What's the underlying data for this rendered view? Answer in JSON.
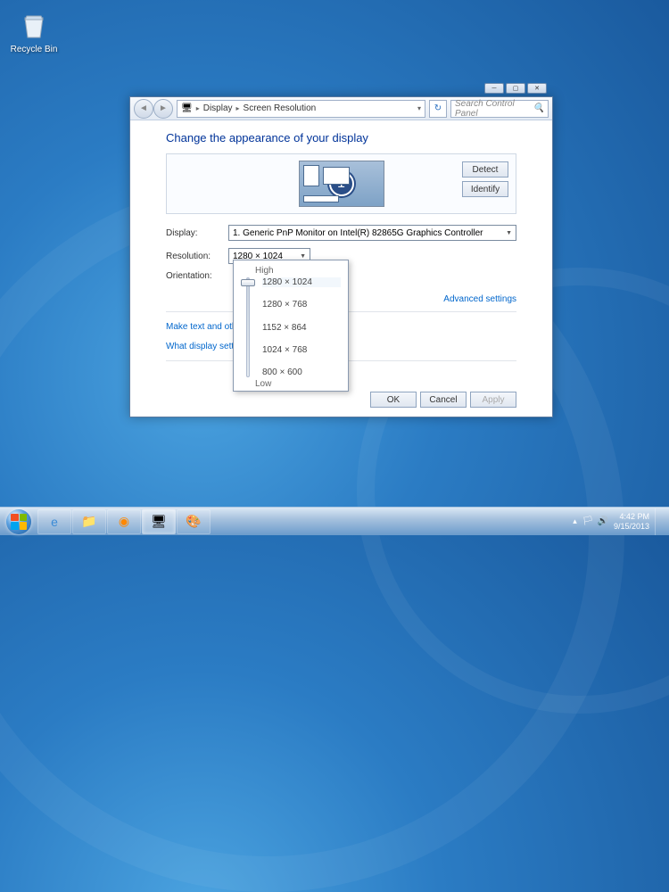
{
  "desktop": {
    "recycle_bin": "Recycle Bin"
  },
  "window": {
    "breadcrumb": {
      "icon": "display-icon",
      "seg1": "Display",
      "seg2": "Screen Resolution"
    },
    "search_placeholder": "Search Control Panel",
    "heading": "Change the appearance of your display",
    "preview": {
      "number": "1",
      "detect": "Detect",
      "identify": "Identify"
    },
    "form": {
      "display_label": "Display:",
      "display_value": "1. Generic PnP Monitor on Intel(R) 82865G Graphics Controller",
      "resolution_label": "Resolution:",
      "resolution_value": "1280 × 1024",
      "orientation_label": "Orientation:"
    },
    "links": {
      "advanced": "Advanced settings",
      "make_text": "Make text and other",
      "what_display": "What display settin"
    },
    "buttons": {
      "ok": "OK",
      "cancel": "Cancel",
      "apply": "Apply"
    },
    "res_popup": {
      "high": "High",
      "low": "Low",
      "options": [
        "1280 × 1024",
        "1280 × 768",
        "1152 × 864",
        "1024 × 768",
        "800 × 600"
      ]
    }
  },
  "taskbar": {
    "time": "4:42 PM",
    "date": "9/15/2013"
  }
}
